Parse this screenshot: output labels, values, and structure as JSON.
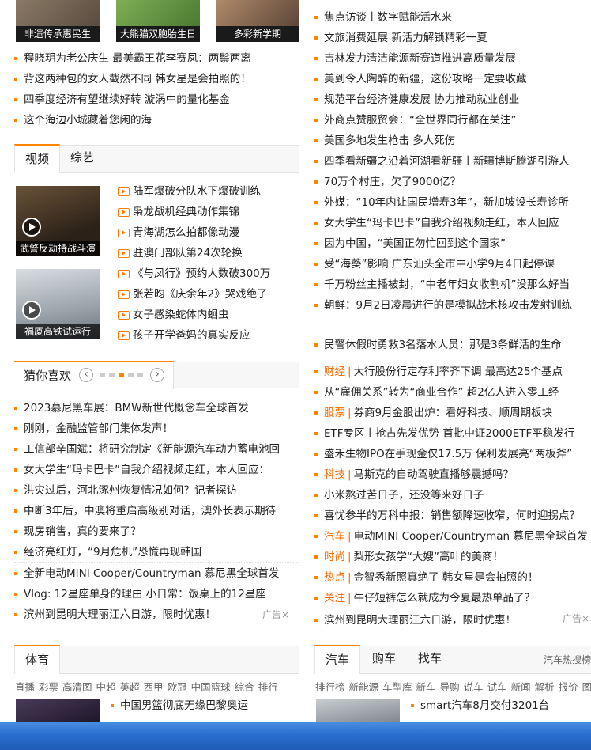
{
  "top_thumbs": [
    {
      "caption": "非遗传承惠民生"
    },
    {
      "caption": "大熊猫双胞胎生日"
    },
    {
      "caption": "多彩新学期"
    }
  ],
  "left_news": [
    "程晓玥为老公庆生 最美霸王花李赛凤：两鬃两离",
    "背这两种包的女人截然不同 韩女星是会拍照的！",
    "四季度经济有望继续好转 漩涡中的量化基金",
    "这个海边小城藏着您闲的海"
  ],
  "video_section": {
    "tabs": [
      "视频",
      "综艺"
    ],
    "thumbs": [
      {
        "caption": "武警反劫持战斗演"
      },
      {
        "caption": "福厦高铁试运行"
      }
    ],
    "items": [
      "陆军爆破分队水下爆破训练",
      "枭龙战机经典动作集锦",
      "青海湖怎么拍都像动漫",
      "驻澳门部队第24次轮换",
      "《与凤行》预约人数破300万",
      "张若昀《庆余年2》哭戏绝了",
      "女子感染蛇体内蛔虫",
      "孩子开学爸妈的真实反应"
    ]
  },
  "guess": {
    "title": "猜你喜欢",
    "prev": "‹",
    "next": "›",
    "items": [
      "2023慕尼黑车展：BMW新世代概念车全球首发",
      "刚刚，金融监管部门集体发声！",
      "工信部辛国斌：将研究制定《新能源汽车动力蓄电池回",
      "女大学生“玛卡巴卡”自我介绍视频走红，本人回应：",
      "洪灾过后，河北涿州恢复情况如何？记者探访",
      "中断3年后，中澳将重启高级别对话，澳外长表示期待",
      "现房销售，真的要来了？",
      "经济亮红灯，“9月危机”恐慌再现韩国"
    ],
    "promo": [
      "全新电动MINI Cooper/Countryman 慕尼黑全球首发",
      "Vlog: 12星座单身的理由 小日常：饭桌上的12星座",
      "滨州到昆明大理丽江六日游，限时优惠！"
    ],
    "ad_label": "广告×"
  },
  "right_news_top": [
    "焦点访谈丨数字赋能活水来",
    "文旅消费延展 新活力解锁精彩一夏",
    "吉林发力清洁能源新赛道推进高质量发展",
    "美到令人陶醉的新疆，这份攻略一定要收藏",
    "规范平台经济健康发展 协力推动就业创业",
    "外商点赞服贸会：“全世界同行都在关注”",
    "美国多地发生枪击 多人死伤",
    "四季看新疆之沿着河湖看新疆丨新疆博斯腾湖引游人",
    "70万个村庄，欠了9000亿？",
    "外媒：“10年内让国民增寿3年”，新加坡设长寿诊所",
    "女大学生“玛卡巴卡”自我介绍视频走红，本人回应",
    "因为中国，“美国正勿忙回到这个国家”",
    "受“海葵”影响 广东汕头全市中小学9月4日起停课",
    "千万粉丝主播被封，“中老年妇女收割机”没那么好当",
    "朝鲜：9月2日凌晨进行的是模拟战术核攻击发射训练"
  ],
  "right_single": "民警休假时勇救3名落水人员：那是3条鲜活的生命",
  "right_news_bottom": [
    {
      "tag": "财经",
      "text": "大行股份行定存利率齐下调 最高达25个基点"
    },
    {
      "tag": "",
      "text": "从“雇佣关系”转为“商业合作” 超2亿人进入零工经"
    },
    {
      "tag": "股票",
      "text": "券商9月金股出炉：看好科技、顺周期板块"
    },
    {
      "tag": "",
      "text": "ETF专区丨抢占先发优势 首批中证2000ETF平稳发行"
    },
    {
      "tag": "",
      "text": "盛禾生物IPO在手现金仅17.5万 保利发展亮“两板斧”"
    },
    {
      "tag": "科技",
      "text": "马斯克的自动驾驶直播够震撼吗？"
    },
    {
      "tag": "",
      "text": "小米熬过苦日子，还没等来好日子"
    },
    {
      "tag": "",
      "text": "喜忧参半的万科中报：销售额降速收窄，何时迎拐点？"
    },
    {
      "tag": "汽车",
      "text": "电动MINI Cooper/Countryman 慕尼黑全球首发"
    },
    {
      "tag": "时尚",
      "text": "梨形女孩学“大嫂”高叶的美商！"
    },
    {
      "tag": "热点",
      "text": "金智秀新照真绝了 韩女星是会拍照的！"
    },
    {
      "tag": "关注",
      "text": "牛仔短裤怎么就成为今夏最热单品了？"
    }
  ],
  "right_promo": "滨州到昆明大理丽江六日游，限时优惠！",
  "right_ad_label": "广告×",
  "sports": {
    "tab": "体育",
    "subnav": [
      "直播",
      "彩票",
      "高清图",
      "中超",
      "英超",
      "西甲",
      "欧冠",
      "中国篮球",
      "综合",
      "排行"
    ],
    "headline": "中国男篮彻底无缘巴黎奥运"
  },
  "auto": {
    "tabs": [
      "汽车",
      "购车",
      "找车"
    ],
    "search_hint": "汽车热搜榜",
    "subnav": [
      "排行榜",
      "新能源",
      "车型库",
      "新车",
      "导购",
      "说车",
      "试车",
      "新闻",
      "解析",
      "报价",
      "图片"
    ],
    "headline": "smart汽车8月交付3201台"
  },
  "colors": {
    "accent": "#ff8400",
    "taskbar": "#2a6fd0"
  }
}
